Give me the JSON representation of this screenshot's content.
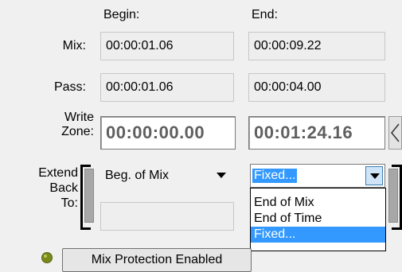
{
  "headers": {
    "begin": "Begin:",
    "end": "End:"
  },
  "rows": {
    "mix": {
      "label": "Mix:",
      "begin": "00:00:01.06",
      "end": "00:00:09.22"
    },
    "pass": {
      "label": "Pass:",
      "begin": "00:00:01.06",
      "end": "00:00:04.00"
    },
    "write_zone": {
      "label_line1": "Write",
      "label_line2": "Zone:",
      "begin": "00:00:00.00",
      "end": "00:01:24.16"
    }
  },
  "extend_back": {
    "label_line1": "Extend",
    "label_line2": "Back",
    "label_line3": "To:",
    "begin_selected": "Beg. of Mix",
    "end_selected": "Fixed...",
    "end_options": [
      "End of Mix",
      "End of Time",
      "Fixed..."
    ]
  },
  "mix_protection": {
    "label": "Mix Protection Enabled",
    "status_color": "#7a8a1a"
  },
  "icons": {
    "nudge_left": "chevron-left-icon",
    "dropdown": "chevron-down-icon",
    "status": "status-dot-icon"
  }
}
